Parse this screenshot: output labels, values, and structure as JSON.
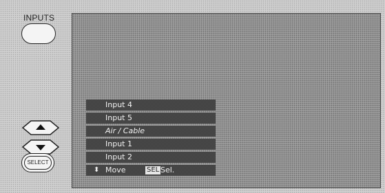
{
  "remote": {
    "inputs_label": "INPUTS",
    "select_label": "SELECT"
  },
  "menu": {
    "items": [
      {
        "label": "Input 4",
        "selected": false
      },
      {
        "label": "Input 5",
        "selected": false
      },
      {
        "label": "Air / Cable",
        "selected": true
      },
      {
        "label": "Input 1",
        "selected": false
      },
      {
        "label": "Input 2",
        "selected": false
      }
    ],
    "hint": {
      "move_label": "Move",
      "sel_key": "SEL",
      "sel_text": "Sel."
    }
  }
}
